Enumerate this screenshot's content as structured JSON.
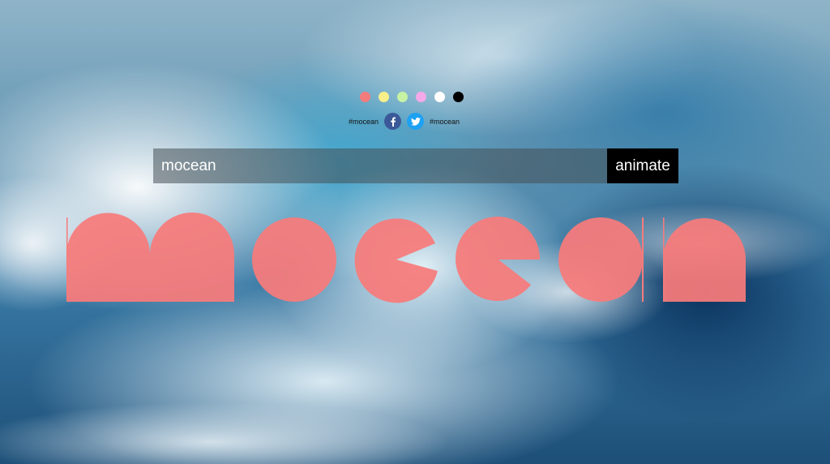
{
  "swatches": [
    {
      "name": "salmon",
      "color": "#f47b7b"
    },
    {
      "name": "yellow",
      "color": "#f7ef8a"
    },
    {
      "name": "light-green",
      "color": "#c6f2a4"
    },
    {
      "name": "pink",
      "color": "#f5a9e8"
    },
    {
      "name": "white",
      "color": "#ffffff"
    },
    {
      "name": "black",
      "color": "#000000"
    }
  ],
  "share": {
    "left_hashtag": "#mocean",
    "right_hashtag": "#mocean",
    "facebook_color": "#3b5998",
    "twitter_color": "#1da1f2"
  },
  "input": {
    "value": "mocean"
  },
  "animate_button": {
    "label": "animate"
  },
  "wordmark": {
    "text": "mocean",
    "color": "#f77b7b"
  }
}
